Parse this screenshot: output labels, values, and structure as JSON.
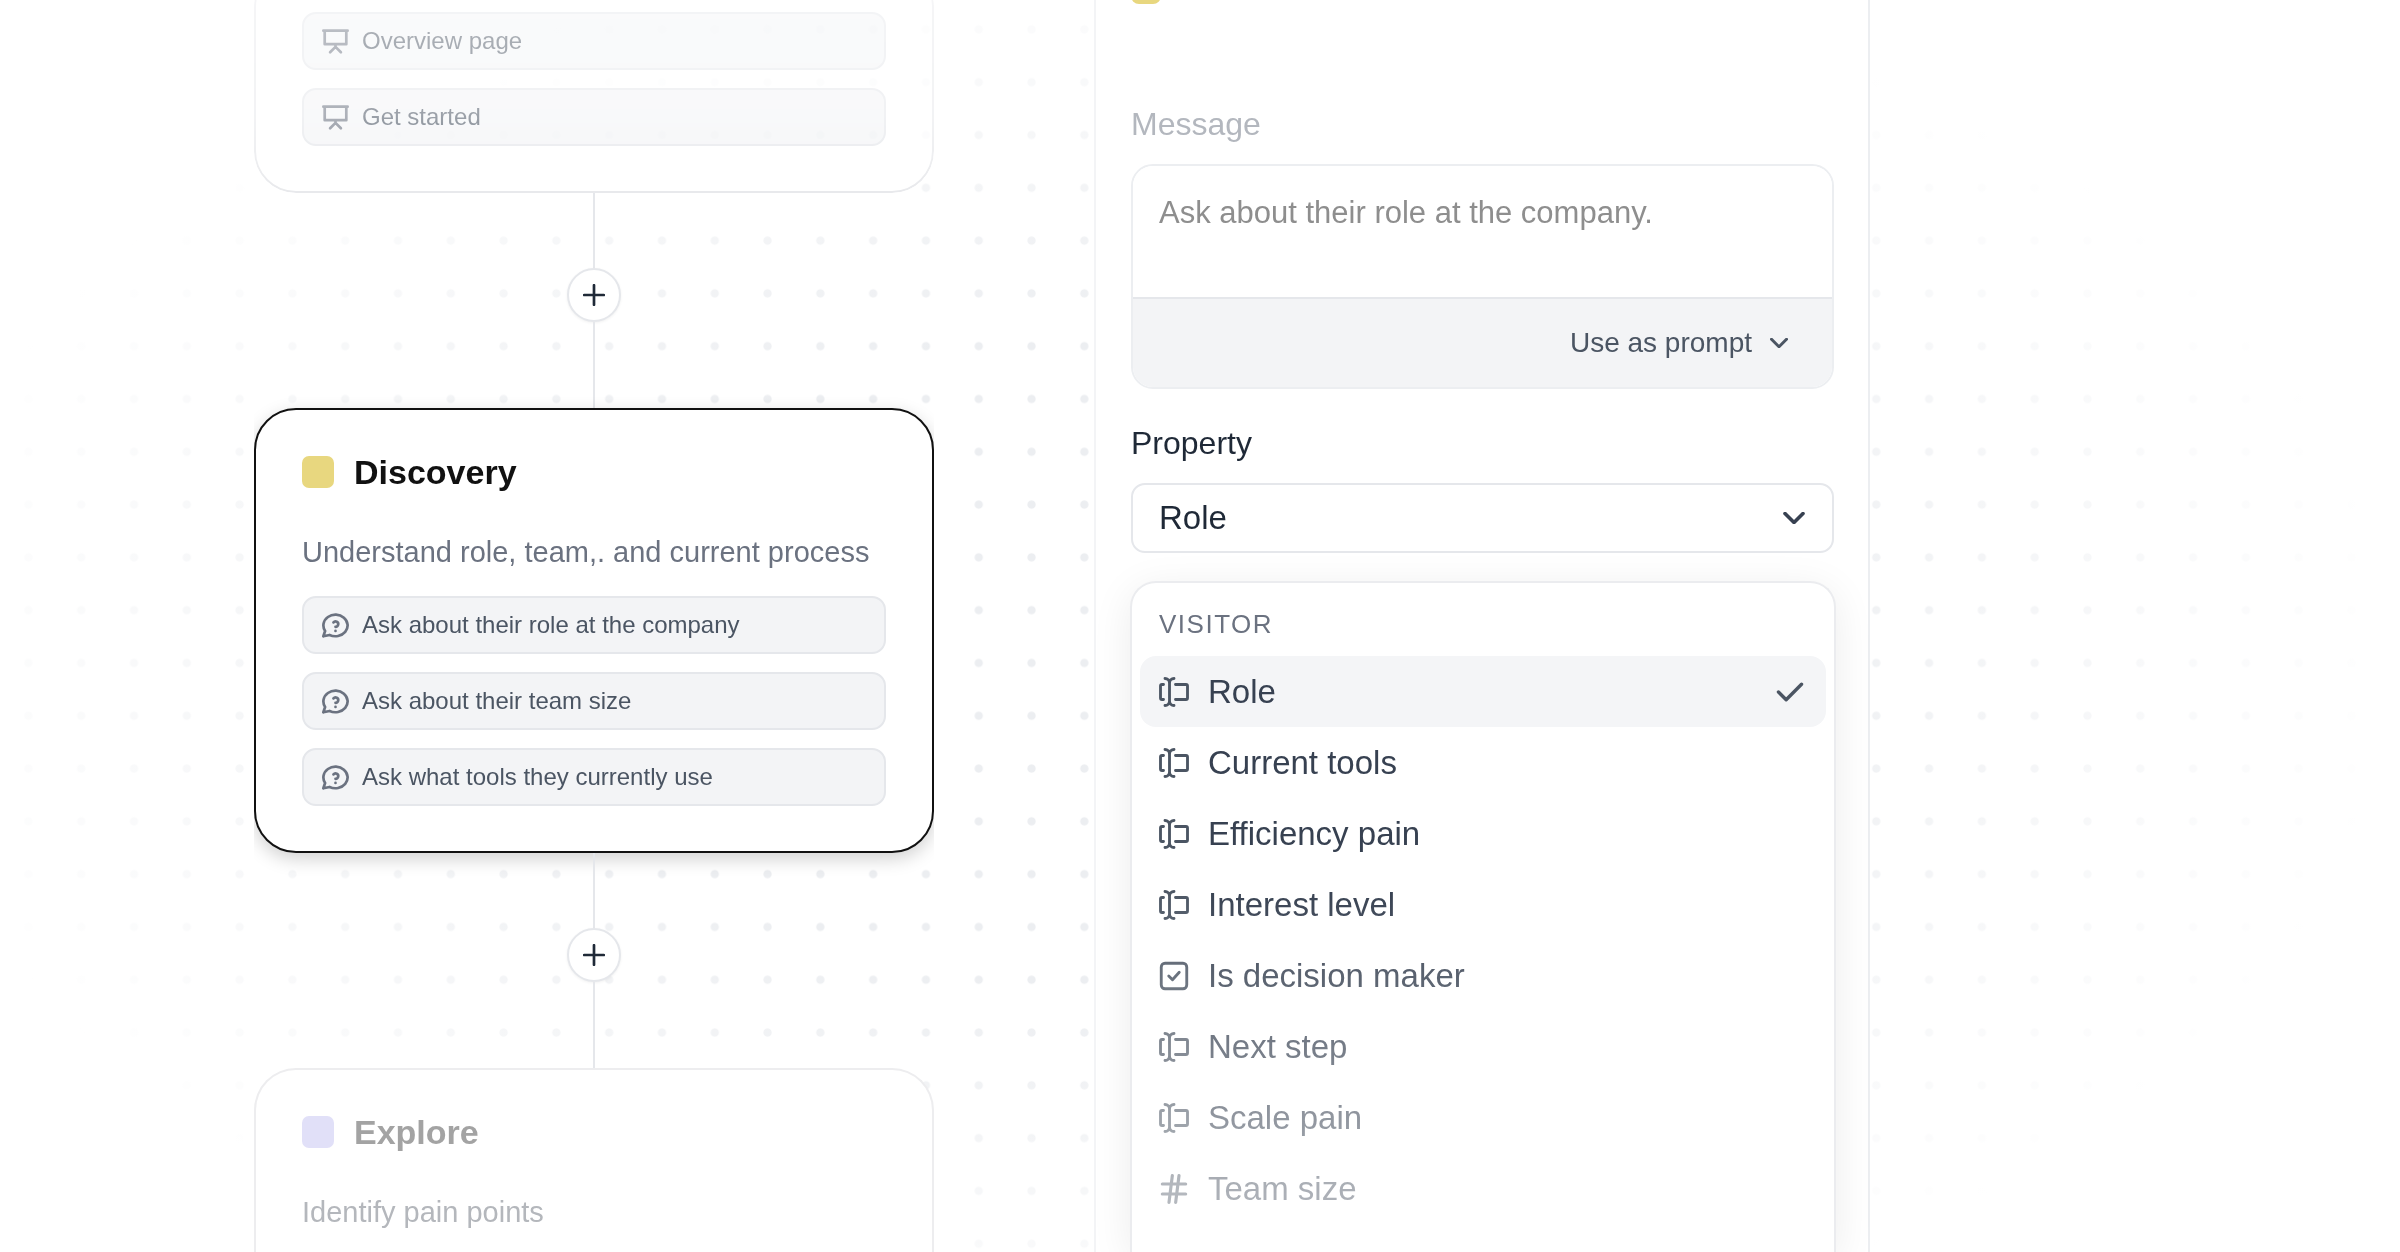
{
  "canvas": {
    "stages": [
      {
        "selected": false,
        "items": [
          {
            "kind": "slide",
            "label": "Overview page"
          },
          {
            "kind": "slide",
            "label": "Get started"
          }
        ]
      },
      {
        "title": "Discovery",
        "color": "#e8d77f",
        "selected": true,
        "description": "Understand role, team,. and current process",
        "items": [
          {
            "kind": "question",
            "label": "Ask about their role at the company"
          },
          {
            "kind": "question",
            "label": "Ask about their team size"
          },
          {
            "kind": "question",
            "label": "Ask what tools they currently use"
          }
        ]
      },
      {
        "title": "Explore",
        "color": "#e1e0f8",
        "selected": false,
        "description": "Identify pain points"
      }
    ]
  },
  "panel": {
    "message": {
      "label": "Message",
      "placeholder": "Ask about their role at the company.",
      "mode": "Use as prompt"
    },
    "property": {
      "label": "Property",
      "value": "Role",
      "menu": {
        "group": "VISITOR",
        "options": [
          {
            "kind": "text",
            "label": "Role",
            "selected": true
          },
          {
            "kind": "text",
            "label": "Current tools",
            "selected": false
          },
          {
            "kind": "text",
            "label": "Efficiency pain",
            "selected": false
          },
          {
            "kind": "text",
            "label": "Interest level",
            "selected": false
          },
          {
            "kind": "boolean",
            "label": "Is decision maker",
            "selected": false
          },
          {
            "kind": "text",
            "label": "Next step",
            "selected": false
          },
          {
            "kind": "text",
            "label": "Scale pain",
            "selected": false
          },
          {
            "kind": "number",
            "label": "Team size",
            "selected": false
          }
        ]
      }
    }
  }
}
